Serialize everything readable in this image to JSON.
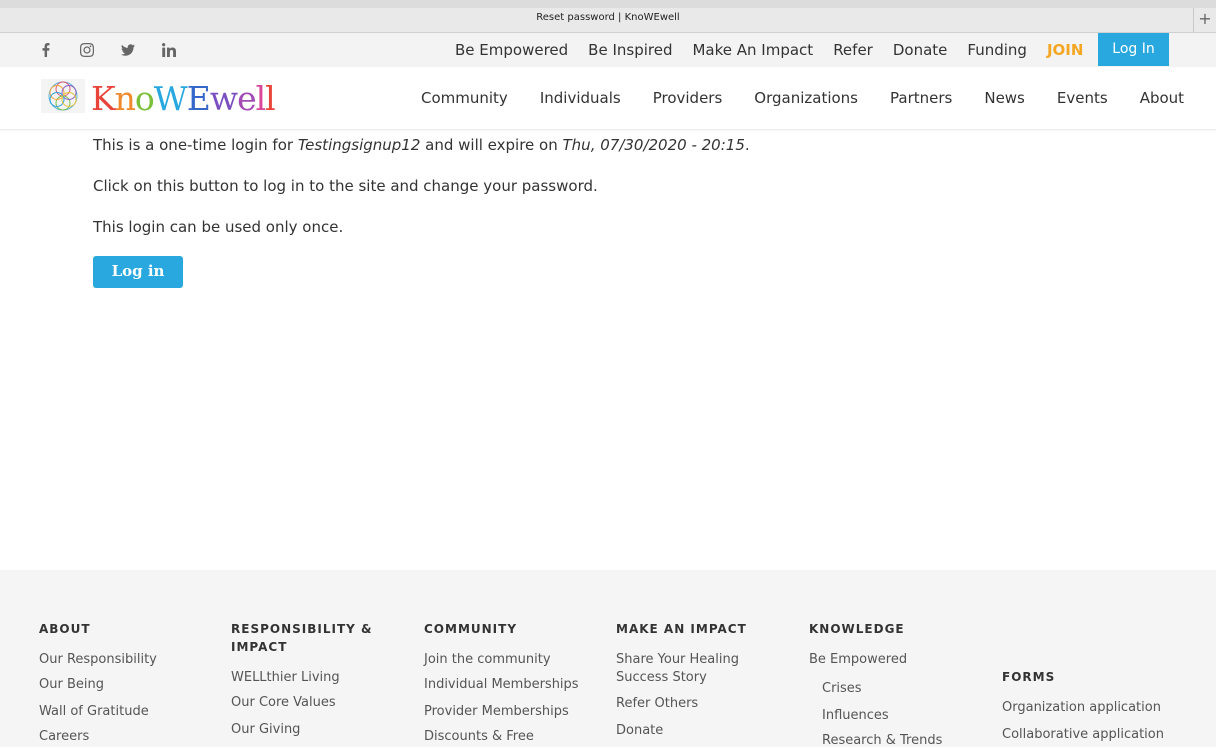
{
  "browser": {
    "title": "Reset password | KnoWEwell"
  },
  "social": [
    "facebook-icon",
    "instagram-icon",
    "twitter-icon",
    "linkedin-icon"
  ],
  "top_nav": {
    "items": [
      "Be Empowered",
      "Be Inspired",
      "Make An Impact",
      "Refer",
      "Donate",
      "Funding"
    ],
    "join": "JOIN",
    "login": "Log In"
  },
  "brand": {
    "letters": [
      "K",
      "n",
      "o",
      "W",
      "E",
      "w",
      "e",
      "l",
      "l"
    ]
  },
  "main_nav": [
    "Community",
    "Individuals",
    "Providers",
    "Organizations",
    "Partners",
    "News",
    "Events",
    "About"
  ],
  "content": {
    "line1_pre": "This is a one-time login for ",
    "user": "Testingsignup12",
    "line1_mid": " and will expire on ",
    "expiry": "Thu, 07/30/2020 - 20:15",
    "line1_end": ".",
    "line2": "Click on this button to log in to the site and change your password.",
    "line3": "This login can be used only once.",
    "button": "Log in"
  },
  "footer": {
    "about": {
      "title": "ABOUT",
      "links": [
        "Our Responsibility",
        "Our Being",
        "Wall of Gratitude",
        "Careers"
      ]
    },
    "responsibility": {
      "title_1": "RESPONSIBILITY &",
      "title_2": "IMPACT",
      "links": [
        "WELLthier Living",
        "Our Core Values",
        "Our Giving"
      ]
    },
    "community": {
      "title": "COMMUNITY",
      "links": [
        "Join the community",
        "Individual Memberships",
        "Provider Memberships",
        "Discounts & Free"
      ]
    },
    "impact": {
      "title": "MAKE AN IMPACT",
      "links": [
        "Share Your Healing",
        "Success Story",
        "Refer Others",
        "Donate"
      ]
    },
    "knowledge": {
      "title": "KNOWLEDGE",
      "links": [
        "Be Empowered",
        "Crises",
        "Influences",
        "Research & Trends"
      ]
    },
    "forms": {
      "title": "FORMS",
      "links": [
        "Organization application",
        "Collaborative application"
      ]
    }
  },
  "colors": {
    "accent": "#29a8e0",
    "join": "#f5a623"
  }
}
